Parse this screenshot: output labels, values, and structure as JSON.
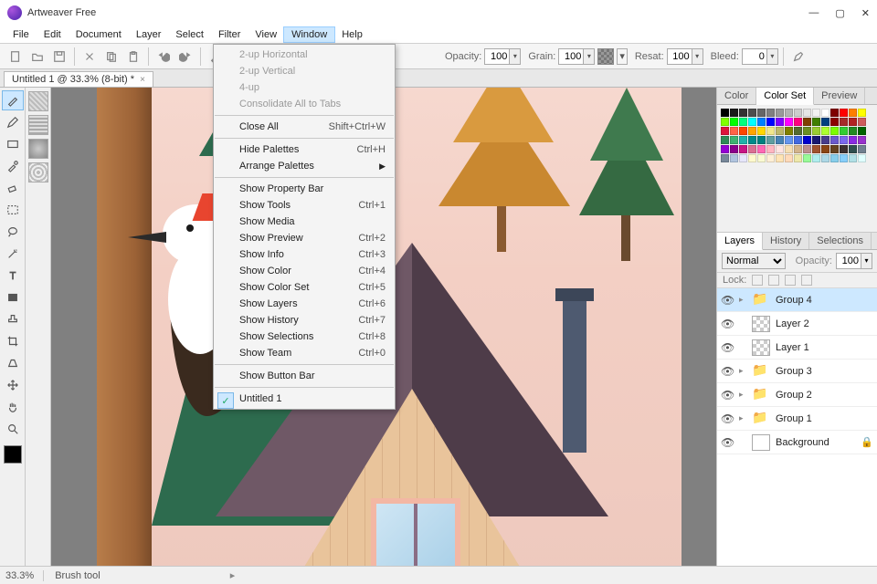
{
  "titlebar": {
    "title": "Artweaver Free"
  },
  "menubar": [
    "File",
    "Edit",
    "Document",
    "Layer",
    "Select",
    "Filter",
    "View",
    "Window",
    "Help"
  ],
  "menubar_active_index": 7,
  "toolbar": {
    "opacity_label": "Opacity:",
    "opacity": "100",
    "grain_label": "Grain:",
    "grain": "100",
    "resat_label": "Resat:",
    "resat": "100",
    "bleed_label": "Bleed:",
    "bleed": "0"
  },
  "doc_tab": {
    "label": "Untitled 1 @ 33.3% (8-bit) *"
  },
  "window_menu": [
    {
      "label": "2-up Horizontal",
      "disabled": true
    },
    {
      "label": "2-up Vertical",
      "disabled": true
    },
    {
      "label": "4-up",
      "disabled": true
    },
    {
      "label": "Consolidate All to Tabs",
      "disabled": true
    },
    {
      "sep": true
    },
    {
      "label": "Close All",
      "shortcut": "Shift+Ctrl+W"
    },
    {
      "sep": true
    },
    {
      "label": "Hide Palettes",
      "shortcut": "Ctrl+H"
    },
    {
      "label": "Arrange Palettes",
      "submenu": true
    },
    {
      "sep": true
    },
    {
      "label": "Show Property Bar"
    },
    {
      "label": "Show Tools",
      "shortcut": "Ctrl+1"
    },
    {
      "label": "Show Media"
    },
    {
      "label": "Show Preview",
      "shortcut": "Ctrl+2"
    },
    {
      "label": "Show Info",
      "shortcut": "Ctrl+3"
    },
    {
      "label": "Show Color",
      "shortcut": "Ctrl+4"
    },
    {
      "label": "Show Color Set",
      "shortcut": "Ctrl+5"
    },
    {
      "label": "Show Layers",
      "shortcut": "Ctrl+6"
    },
    {
      "label": "Show History",
      "shortcut": "Ctrl+7"
    },
    {
      "label": "Show Selections",
      "shortcut": "Ctrl+8"
    },
    {
      "label": "Show Team",
      "shortcut": "Ctrl+0"
    },
    {
      "sep": true
    },
    {
      "label": "Show Button Bar"
    },
    {
      "sep": true
    },
    {
      "label": "Untitled 1",
      "checked": true
    }
  ],
  "right_tabs_top": [
    "Color",
    "Color Set",
    "Preview"
  ],
  "right_tabs_top_active": 1,
  "right_tabs_bottom": [
    "Layers",
    "History",
    "Selections"
  ],
  "right_tabs_bottom_active": 0,
  "layer_panel": {
    "blend": "Normal",
    "opacity_label": "Opacity:",
    "opacity": "100",
    "lock_label": "Lock:"
  },
  "layers": [
    {
      "name": "Group 4",
      "folder": true,
      "selected": true,
      "expandable": true
    },
    {
      "name": "Layer 2",
      "thumb": "checker"
    },
    {
      "name": "Layer 1",
      "thumb": "checker"
    },
    {
      "name": "Group 3",
      "folder": true,
      "expandable": true
    },
    {
      "name": "Group 2",
      "folder": true,
      "expandable": true
    },
    {
      "name": "Group 1",
      "folder": true,
      "expandable": true
    },
    {
      "name": "Background",
      "thumb": "white",
      "locked": true
    }
  ],
  "colorset": [
    "#000000",
    "#1a1a1a",
    "#333333",
    "#4d4d4d",
    "#666666",
    "#808080",
    "#999999",
    "#b3b3b3",
    "#cccccc",
    "#e6e6e6",
    "#f2f2f2",
    "#ffffff",
    "#7f0000",
    "#ff0000",
    "#ff7f00",
    "#ffff00",
    "#7fff00",
    "#00ff00",
    "#00ff7f",
    "#00ffff",
    "#007fff",
    "#0000ff",
    "#7f00ff",
    "#ff00ff",
    "#ff007f",
    "#7f3f00",
    "#3f7f00",
    "#003f7f",
    "#8b0000",
    "#a52a2a",
    "#b22222",
    "#cd5c5c",
    "#dc143c",
    "#ff6347",
    "#ff4500",
    "#ffa500",
    "#ffd700",
    "#f0e68c",
    "#bdb76b",
    "#808000",
    "#556b2f",
    "#6b8e23",
    "#9acd32",
    "#adff2f",
    "#7cfc00",
    "#32cd32",
    "#228b22",
    "#006400",
    "#2e8b57",
    "#3cb371",
    "#20b2aa",
    "#008b8b",
    "#008080",
    "#5f9ea0",
    "#4682b4",
    "#6495ed",
    "#4169e1",
    "#0000cd",
    "#191970",
    "#483d8b",
    "#6a5acd",
    "#7b68ee",
    "#8a2be2",
    "#9932cc",
    "#9400d3",
    "#8b008b",
    "#c71585",
    "#db7093",
    "#ff69b4",
    "#ffb6c1",
    "#ffe4e1",
    "#f5deb3",
    "#d2b48c",
    "#bc8f8f",
    "#a0522d",
    "#8b4513",
    "#654321",
    "#3b2f2f",
    "#2f4f4f",
    "#708090",
    "#778899",
    "#b0c4de",
    "#e6e6fa",
    "#fffacd",
    "#fafad2",
    "#ffefd5",
    "#ffe4b5",
    "#ffdab9",
    "#eee8aa",
    "#98fb98",
    "#afeeee",
    "#add8e6",
    "#87ceeb",
    "#87cefa",
    "#b0e0e6",
    "#e0ffff"
  ],
  "status": {
    "zoom": "33.3%",
    "tool": "Brush tool"
  }
}
